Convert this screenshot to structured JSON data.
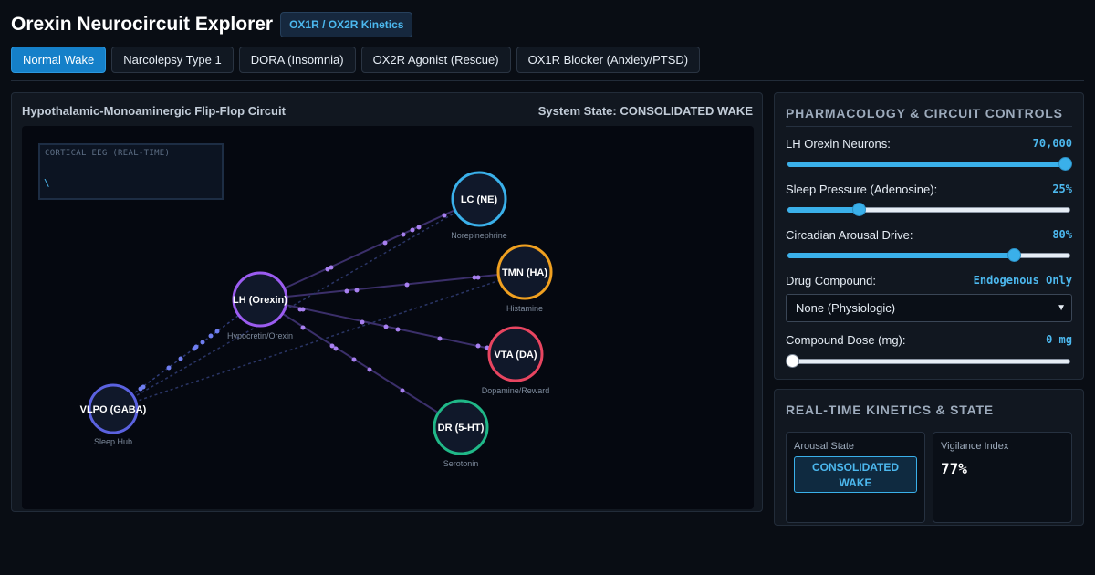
{
  "header": {
    "title": "Orexin Neurocircuit Explorer",
    "badge": "OX1R / OX2R Kinetics"
  },
  "tabs": [
    {
      "label": "Normal Wake",
      "active": true
    },
    {
      "label": "Narcolepsy Type 1",
      "active": false
    },
    {
      "label": "DORA (Insomnia)",
      "active": false
    },
    {
      "label": "OX2R Agonist (Rescue)",
      "active": false
    },
    {
      "label": "OX1R Blocker (Anxiety/PTSD)",
      "active": false
    }
  ],
  "circuit": {
    "title": "Hypothalamic-Monoaminergic Flip-Flop Circuit",
    "system_state": "System State: CONSOLIDATED WAKE",
    "eeg_label": "CORTICAL EEG (REAL-TIME)",
    "eeg_trace": "\\",
    "nodes": [
      {
        "id": "lh",
        "label": "LH (Orexin)",
        "sub": "Hypocretin/Orexin",
        "color": "#9b5cf0"
      },
      {
        "id": "lc",
        "label": "LC (NE)",
        "sub": "Norepinephrine",
        "color": "#3ab0ea"
      },
      {
        "id": "tmn",
        "label": "TMN (HA)",
        "sub": "Histamine",
        "color": "#f0a020"
      },
      {
        "id": "vta",
        "label": "VTA (DA)",
        "sub": "Dopamine/Reward",
        "color": "#e84560"
      },
      {
        "id": "dr",
        "label": "DR (5-HT)",
        "sub": "Serotonin",
        "color": "#20b888"
      },
      {
        "id": "vlpo",
        "label": "VLPO (GABA)",
        "sub": "Sleep Hub",
        "color": "#5b62e0"
      }
    ]
  },
  "controls": {
    "title": "PHARMACOLOGY & CIRCUIT CONTROLS",
    "orexin": {
      "label": "LH Orexin Neurons:",
      "value": "70,000",
      "level": 1.0
    },
    "sleep_pressure": {
      "label": "Sleep Pressure (Adenosine):",
      "value": "25%",
      "level": 0.25
    },
    "circadian": {
      "label": "Circadian Arousal Drive:",
      "value": "80%",
      "level": 0.8
    },
    "drug": {
      "label": "Drug Compound:",
      "value": "Endogenous Only",
      "selected": "None (Physiologic)"
    },
    "dose": {
      "label": "Compound Dose (mg):",
      "value": "0 mg",
      "level": 0.0
    }
  },
  "kinetics": {
    "title": "REAL-TIME KINETICS & STATE",
    "arousal": {
      "label": "Arousal State",
      "value_line1": "CONSOLIDATED",
      "value_line2": "WAKE"
    },
    "vigilance": {
      "label": "Vigilance Index",
      "value": "77%"
    }
  }
}
